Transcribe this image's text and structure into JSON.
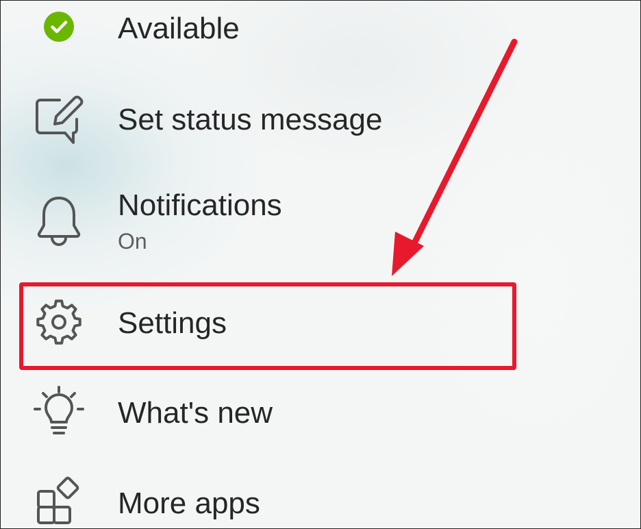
{
  "menu": {
    "items": [
      {
        "id": "available",
        "label": "Available",
        "icon": "check-circle-icon",
        "status_color": "#6bb700"
      },
      {
        "id": "status",
        "label": "Set status message",
        "icon": "edit-message-icon"
      },
      {
        "id": "notifications",
        "label": "Notifications",
        "sublabel": "On",
        "icon": "bell-icon"
      },
      {
        "id": "settings",
        "label": "Settings",
        "icon": "gear-icon",
        "highlighted": true
      },
      {
        "id": "whats-new",
        "label": "What's new",
        "icon": "lightbulb-icon"
      },
      {
        "id": "more-apps",
        "label": "More apps",
        "icon": "apps-icon"
      }
    ]
  },
  "annotation": {
    "color": "#e8192c",
    "target": "settings"
  }
}
